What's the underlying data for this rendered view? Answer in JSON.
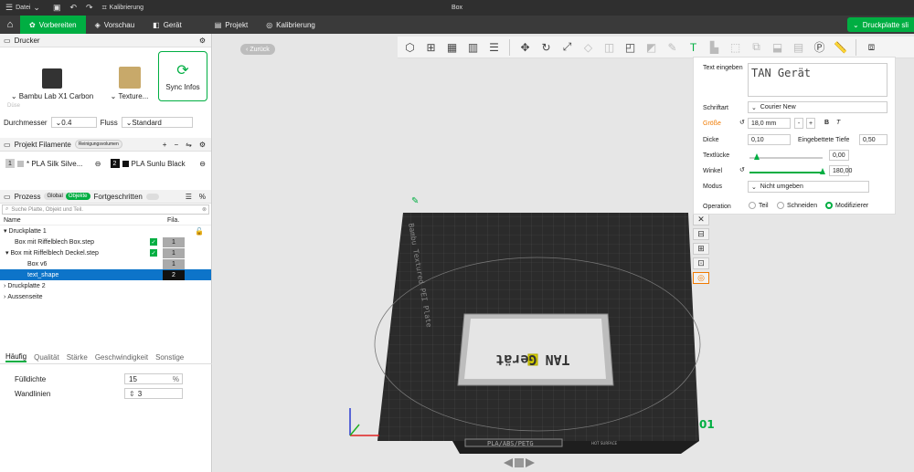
{
  "titlebar": {
    "menu": "Datei",
    "calib": "Kalibrierung",
    "title": "Box"
  },
  "nav": {
    "tabs": [
      {
        "label": "Vorbereiten",
        "icon": "prepare-icon",
        "glyph": "✿"
      },
      {
        "label": "Vorschau",
        "icon": "preview-icon",
        "glyph": "◈"
      },
      {
        "label": "Gerät",
        "icon": "device-icon",
        "glyph": "◧"
      },
      {
        "label": "Projekt",
        "icon": "project-icon",
        "glyph": "▤"
      },
      {
        "label": "Kalibrierung",
        "icon": "calibration-icon",
        "glyph": "◎"
      }
    ],
    "slice_label": "Druckplatte sli"
  },
  "printer": {
    "section_title": "Drucker",
    "name": "Bambu Lab X1 Carbon",
    "plate": "Texture...",
    "sync": "Sync Infos",
    "nozzle_section": "Düse",
    "diameter_label": "Durchmesser",
    "diameter_value": "0.4",
    "flow_label": "Fluss",
    "flow_value": "Standard"
  },
  "filaments": {
    "section_title": "Projekt Filamente",
    "clean_label": "Reinigungsvolumen",
    "items": [
      {
        "num": "1",
        "name": "* PLA Silk Silve...",
        "color": "#c0c0c0"
      },
      {
        "num": "2",
        "name": "PLA Sunlu Black",
        "color": "#111111"
      }
    ]
  },
  "process": {
    "section_title": "Prozess",
    "global": "Global",
    "objects": "Objekte",
    "advanced": "Fortgeschritten",
    "search_placeholder": "Suche Platte, Objekt und Teil.",
    "col_name": "Name",
    "col_fila": "Fila."
  },
  "tree": [
    {
      "label": "Druckplatte 1",
      "arrow": "▾",
      "indent": 4,
      "cb": false,
      "fila": ""
    },
    {
      "label": "Box mit Riffelblech Box.step",
      "arrow": "",
      "indent": 14,
      "cb": true,
      "fila": "1"
    },
    {
      "label": "Box mit Riffelblech Deckel.step",
      "arrow": "▾",
      "indent": 6,
      "cb": true,
      "fila": "1"
    },
    {
      "label": "Box v6",
      "arrow": "",
      "indent": 28,
      "cb": false,
      "fila": "1"
    },
    {
      "label": "text_shape",
      "arrow": "",
      "indent": 28,
      "cb": false,
      "fila": "2",
      "selected": true
    },
    {
      "label": "Druckplatte 2",
      "arrow": "›",
      "indent": 4,
      "cb": false,
      "fila": ""
    },
    {
      "label": "Aussenseite",
      "arrow": "›",
      "indent": 4,
      "cb": false,
      "fila": ""
    }
  ],
  "settings_tabs": [
    "Häufig",
    "Qualität",
    "Stärke",
    "Geschwindigkeit",
    "Sonstige"
  ],
  "params": {
    "fill_label": "Fülldichte",
    "fill_value": "15",
    "fill_unit": "%",
    "walls_label": "Wandlinien",
    "walls_value": "3"
  },
  "viewport": {
    "back": "Zurück",
    "plate_num": "01",
    "bed_text": "Bambu Textured PEI Plate",
    "bed_bottom": "PLA/ABS/PETG",
    "bed_small": "HOT SURFACE",
    "model_text": "TAN Gerät"
  },
  "textpanel": {
    "text_label": "Text eingeben",
    "text_value": "TAN Gerät",
    "font_label": "Schriftart",
    "font_value": "Courier New",
    "size_label": "Größe",
    "size_value": "18,0 mm",
    "bold": "B",
    "italic": "T",
    "thickness_label": "Dicke",
    "thickness_value": "0,10",
    "embed_label": "Eingebettete Tiefe",
    "embed_value": "0,50",
    "gap_label": "Textlücke",
    "gap_value": "0,00",
    "angle_label": "Winkel",
    "angle_value": "180,00",
    "mode_label": "Modus",
    "mode_value": "Nicht umgeben",
    "op_label": "Operation",
    "op_part": "Teil",
    "op_cut": "Schneiden",
    "op_modify": "Modifizierer"
  },
  "colors": {
    "accent": "#00ae42",
    "selection": "#0d74c9",
    "bed": "#2b2b2b"
  }
}
